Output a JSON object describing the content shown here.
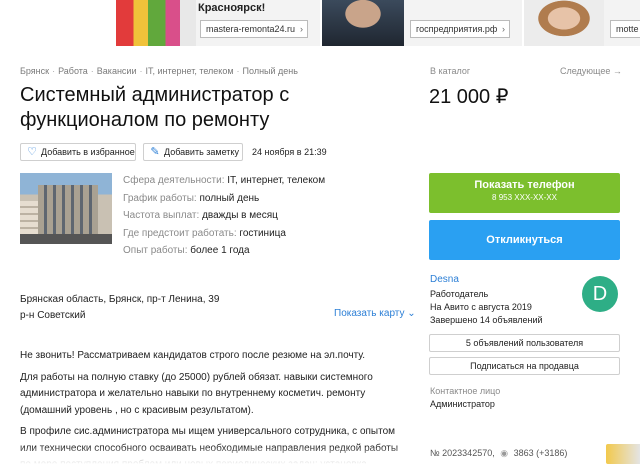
{
  "ads": [
    {
      "headline": "Красноярск!",
      "url": "mastera-remonta24.ru"
    },
    {
      "url": "госпредприятия.рф"
    },
    {
      "url": "motte"
    }
  ],
  "breadcrumbs": [
    "Брянск",
    "Работа",
    "Вакансии",
    "IT, интернет, телеком",
    "Полный день"
  ],
  "title": "Системный администратор с функционалом по ремонту",
  "actions": {
    "favorite": "Добавить в избранное",
    "note": "Добавить заметку"
  },
  "date": "24 ноября в 21:39",
  "props": [
    {
      "label": "Сфера деятельности:",
      "value": "IT, интернет, телеком"
    },
    {
      "label": "График работы:",
      "value": "полный день"
    },
    {
      "label": "Частота выплат:",
      "value": "дважды в месяц"
    },
    {
      "label": "Где предстоит работать:",
      "value": "гостиница"
    },
    {
      "label": "Опыт работы:",
      "value": "более 1 года"
    }
  ],
  "address": {
    "line1": "Брянская область, Брянск, пр-т Ленина, 39",
    "line2": "р-н Советский",
    "show_map": "Показать карту"
  },
  "description": [
    "Не звонить! Рассматриваем кандидатов строго после резюме на эл.почту.",
    "Для работы на полную ставку (до 25000) рублей обязат. навыки системного администратора и желательно навыки по внутреннему косметич. ремонту (домашний уровень , но с красивым результатом).",
    "В профиле сис.администратора мы ищем универсального сотрудника, с опытом или технически способного осваивать необходимые направления редкой работы по мере поступления проблем или новых периодических задач: установка"
  ],
  "sidebar": {
    "catalog": "В каталог",
    "next": "Следующее →",
    "price": "21 000 ₽",
    "phone_button": "Показать телефон",
    "phone_masked": "8 953 XXX-XX-XX",
    "respond_button": "Откликнуться",
    "seller": {
      "name": "Desna",
      "role": "Работодатель",
      "since": "На Авито с августа 2019",
      "completed": "Завершено 14 объявлений",
      "avatar_letter": "D",
      "avatar_color": "#2eae86"
    },
    "user_ads_button": "5 объявлений пользователя",
    "subscribe_button": "Подписаться на продавца",
    "contact_label": "Контактное лицо",
    "contact_value": "Администратор",
    "ad_number": "№ 2023342570,",
    "views": "3863 (+3186)"
  },
  "colors": {
    "link": "#2c7fd6",
    "phone_button": "#7cbf2d",
    "respond_button": "#2aa0f2"
  }
}
